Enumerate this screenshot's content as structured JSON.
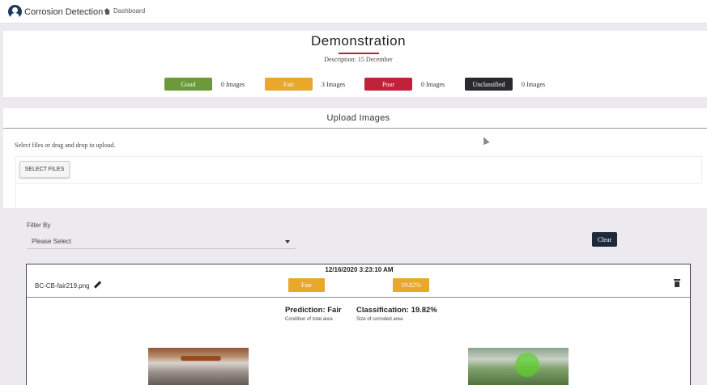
{
  "navbar": {
    "brand": "Corrosion Detection",
    "dashboard_link": "Dashboard"
  },
  "demo": {
    "title": "Demonstration",
    "description": "Description: 15 December",
    "legend": [
      {
        "label": "Good",
        "count": "0 Images",
        "color": "#6c9a3b"
      },
      {
        "label": "Fair",
        "count": "3 Images",
        "color": "#e7a82c"
      },
      {
        "label": "Poor",
        "count": "0 Images",
        "color": "#c1223a"
      },
      {
        "label": "Unclassified",
        "count": "0 Images",
        "color": "#2a2a2e"
      }
    ]
  },
  "upload": {
    "title": "Upload Images",
    "hint": "Select files or drag and drop to upload.",
    "select_button": "SELECT FILES"
  },
  "filter": {
    "label": "Filter By",
    "selected": "Please Select",
    "clear_button": "Clear"
  },
  "result": {
    "timestamp": "12/16/2020 3:23:10 AM",
    "filename": "BC-CB-fair219.png",
    "condition_badge": "Fair",
    "percent_badge": "19.82%",
    "prediction_title": "Prediction: Fair",
    "prediction_sub": "Condition of total area",
    "classification_title": "Classification: 19.82%",
    "classification_sub": "Size of corroded area"
  },
  "icons": [
    "user-logo-icon",
    "home-icon",
    "pencil-icon",
    "trash-icon",
    "chevron-down-icon"
  ]
}
